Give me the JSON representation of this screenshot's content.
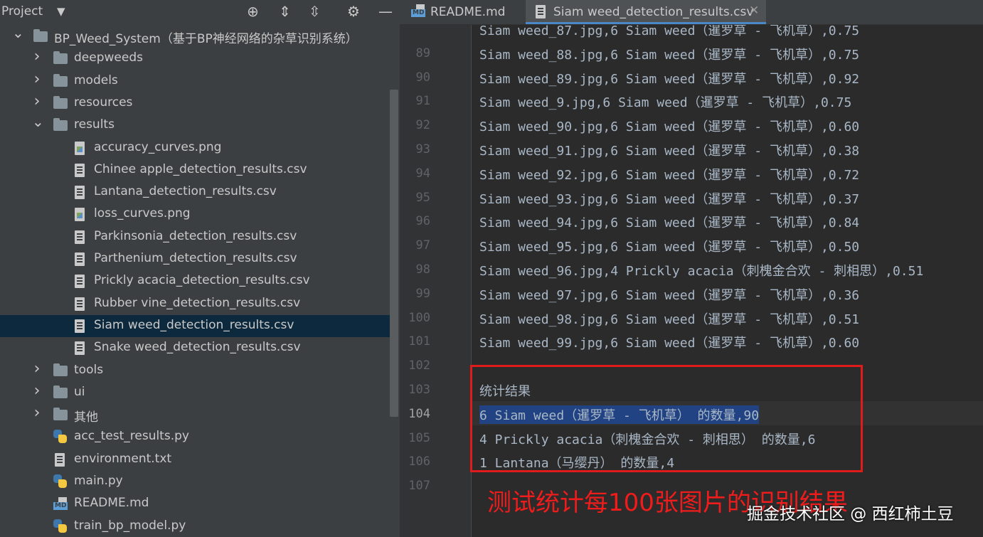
{
  "project_panel": {
    "title": "Project",
    "tree": [
      {
        "type": "folder",
        "label": "BP_Weed_System（基于BP神经网络的杂草识别系统）",
        "level": 0,
        "expanded": true
      },
      {
        "type": "folder",
        "label": "deepweeds",
        "level": 1,
        "expanded": false
      },
      {
        "type": "folder",
        "label": "models",
        "level": 1,
        "expanded": false
      },
      {
        "type": "folder",
        "label": "resources",
        "level": 1,
        "expanded": false
      },
      {
        "type": "folder",
        "label": "results",
        "level": 1,
        "expanded": true
      },
      {
        "type": "png",
        "label": "accuracy_curves.png",
        "level": 2
      },
      {
        "type": "csv",
        "label": "Chinee apple_detection_results.csv",
        "level": 2
      },
      {
        "type": "csv",
        "label": "Lantana_detection_results.csv",
        "level": 2
      },
      {
        "type": "png",
        "label": "loss_curves.png",
        "level": 2
      },
      {
        "type": "csv",
        "label": "Parkinsonia_detection_results.csv",
        "level": 2
      },
      {
        "type": "csv",
        "label": "Parthenium_detection_results.csv",
        "level": 2
      },
      {
        "type": "csv",
        "label": "Prickly acacia_detection_results.csv",
        "level": 2
      },
      {
        "type": "csv",
        "label": "Rubber vine_detection_results.csv",
        "level": 2
      },
      {
        "type": "csv",
        "label": "Siam weed_detection_results.csv",
        "level": 2,
        "selected": true
      },
      {
        "type": "csv",
        "label": "Snake weed_detection_results.csv",
        "level": 2
      },
      {
        "type": "folder",
        "label": "tools",
        "level": 1,
        "expanded": false
      },
      {
        "type": "folder",
        "label": "ui",
        "level": 1,
        "expanded": false
      },
      {
        "type": "folder",
        "label": "其他",
        "level": 1,
        "expanded": false
      },
      {
        "type": "py",
        "label": "acc_test_results.py",
        "level": 1
      },
      {
        "type": "txt",
        "label": "environment.txt",
        "level": 1
      },
      {
        "type": "py",
        "label": "main.py",
        "level": 1
      },
      {
        "type": "md",
        "label": "README.md",
        "level": 1
      },
      {
        "type": "py",
        "label": "train_bp_model.py",
        "level": 1
      }
    ]
  },
  "tabs": [
    {
      "label": "README.md",
      "icon": "md-file-icon",
      "active": false
    },
    {
      "label": "Siam weed_detection_results.csv",
      "icon": "csv-file-icon",
      "active": true,
      "close": "✕"
    }
  ],
  "editor": {
    "current_line": 104,
    "lines": [
      {
        "n": "",
        "text": "Siam weed_87.jpg,6 Siam weed（暹罗草 - 飞机草）,0.75"
      },
      {
        "n": "89",
        "text": "Siam weed_88.jpg,6 Siam weed（暹罗草 - 飞机草）,0.75"
      },
      {
        "n": "90",
        "text": "Siam weed_89.jpg,6 Siam weed（暹罗草 - 飞机草）,0.92"
      },
      {
        "n": "91",
        "text": "Siam weed_9.jpg,6 Siam weed（暹罗草 - 飞机草）,0.75"
      },
      {
        "n": "92",
        "text": "Siam weed_90.jpg,6 Siam weed（暹罗草 - 飞机草）,0.60"
      },
      {
        "n": "93",
        "text": "Siam weed_91.jpg,6 Siam weed（暹罗草 - 飞机草）,0.38"
      },
      {
        "n": "94",
        "text": "Siam weed_92.jpg,6 Siam weed（暹罗草 - 飞机草）,0.72"
      },
      {
        "n": "95",
        "text": "Siam weed_93.jpg,6 Siam weed（暹罗草 - 飞机草）,0.37"
      },
      {
        "n": "96",
        "text": "Siam weed_94.jpg,6 Siam weed（暹罗草 - 飞机草）,0.84"
      },
      {
        "n": "97",
        "text": "Siam weed_95.jpg,6 Siam weed（暹罗草 - 飞机草）,0.50"
      },
      {
        "n": "98",
        "text": "Siam weed_96.jpg,4 Prickly acacia（刺槐金合欢 - 刺相思）,0.51"
      },
      {
        "n": "99",
        "text": "Siam weed_97.jpg,6 Siam weed（暹罗草 - 飞机草）,0.36"
      },
      {
        "n": "100",
        "text": "Siam weed_98.jpg,6 Siam weed（暹罗草 - 飞机草）,0.51"
      },
      {
        "n": "101",
        "text": "Siam weed_99.jpg,6 Siam weed（暹罗草 - 飞机草）,0.60"
      },
      {
        "n": "102",
        "text": ""
      },
      {
        "n": "103",
        "text": "统计结果"
      },
      {
        "n": "104",
        "text": "6 Siam weed（暹罗草 - 飞机草） 的数量,90",
        "selected": true
      },
      {
        "n": "105",
        "text": "4 Prickly acacia（刺槐金合欢 - 刺相思） 的数量,6"
      },
      {
        "n": "106",
        "text": "1 Lantana（马缨丹） 的数量,4"
      },
      {
        "n": "107",
        "text": ""
      }
    ]
  },
  "annotation": {
    "caption": "测试统计每100张图片的识别结果",
    "color": "#e01b1b"
  },
  "watermark": "掘金技术社区 @ 西红柿土豆",
  "colors": {
    "accent": "#4a88c7",
    "selection": "#0d293e",
    "text_selection": "#214283"
  }
}
